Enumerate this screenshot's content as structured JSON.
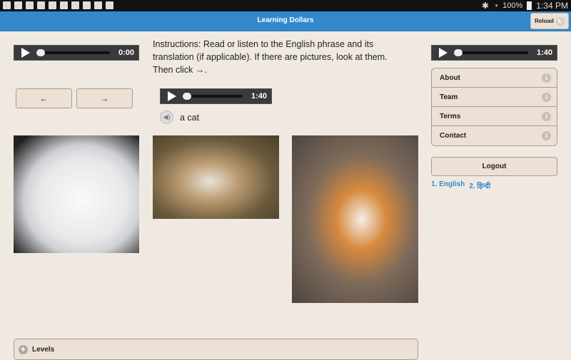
{
  "status_bar": {
    "battery": "100%",
    "time": "1:34 PM"
  },
  "header": {
    "title": "Learning Dollars",
    "reload_label": "Reload"
  },
  "audio_left": {
    "time": "0:00",
    "progress": 0
  },
  "instructions": "Instructions: Read or listen to the English phrase and its translation (if applicable). If there are pictures, look at them. Then click →.",
  "nav": {
    "prev": "←",
    "next": "→"
  },
  "audio_phrase": {
    "time": "1:40",
    "progress": 0
  },
  "phrase": "a cat",
  "audio_right": {
    "time": "1:40",
    "progress": 0
  },
  "menu": [
    {
      "label": "About"
    },
    {
      "label": "Team"
    },
    {
      "label": "Terms"
    },
    {
      "label": "Contact"
    }
  ],
  "logout_label": "Logout",
  "languages": [
    "1. English",
    "2. हिन्दी"
  ],
  "levels_label": "Levels"
}
